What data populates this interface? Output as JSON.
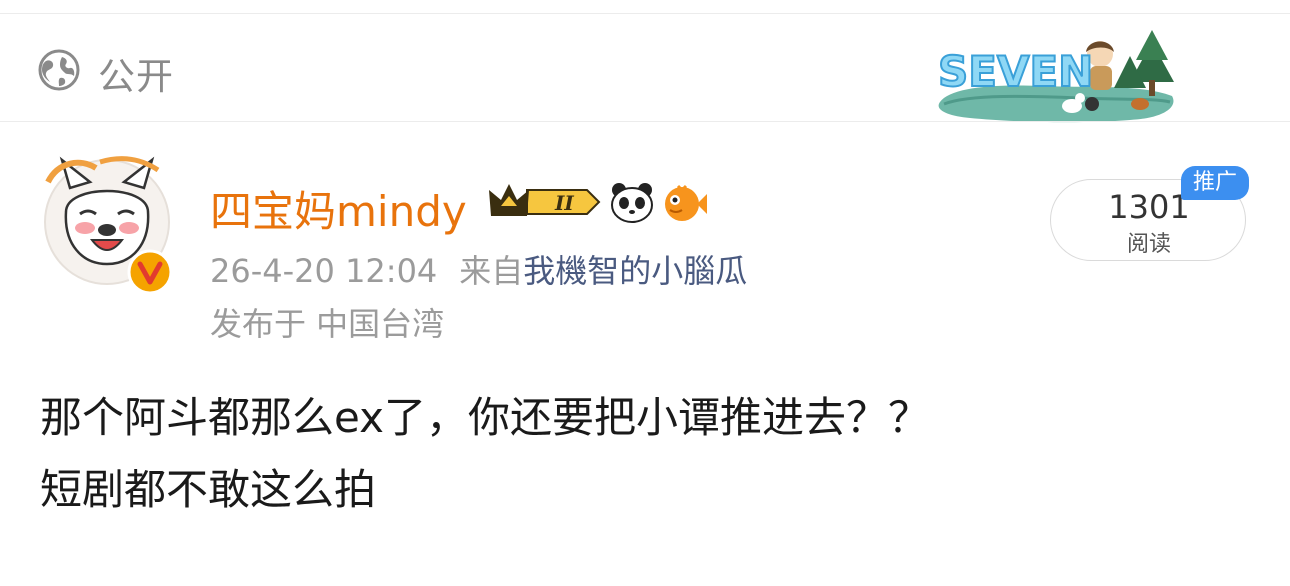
{
  "header": {
    "visibility_label": "公开",
    "visibility_icon": "globe-icon",
    "badge_icon": "seven-fan-badge-icon"
  },
  "post": {
    "author": {
      "name": "四宝妈mindy",
      "avatar": "french-bulldog-avatar",
      "verified_icon": "verified-v-icon",
      "badges": [
        "crown-level-2-icon",
        "panda-icon",
        "pufferfish-icon"
      ]
    },
    "time": "26-4-20 12:04",
    "source_prefix": "来自",
    "source": "我機智的小腦瓜",
    "location": "发布于 中国台湾",
    "reads": {
      "count": "1301",
      "label": "阅读"
    },
    "promo_label": "推广",
    "content_lines": [
      "那个阿斗都那么ex了，你还要把小谭推进去？？",
      "短剧都不敢这么拍"
    ]
  },
  "colors": {
    "username": "#e8730c",
    "source_link": "#4a5a80",
    "promo": "#3c8ff0",
    "meta": "#9b9b9b"
  }
}
